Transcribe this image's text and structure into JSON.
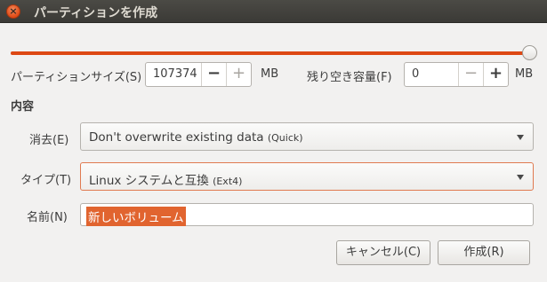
{
  "window": {
    "title": "パーティションを作成",
    "close_glyph": "×"
  },
  "slider": {
    "fill_fraction": 1.0,
    "accent": "#dd4814"
  },
  "size_field": {
    "label": "パーティションサイズ(S)",
    "value": "107374",
    "minus": "−",
    "plus": "+",
    "unit": "MB"
  },
  "free_field": {
    "label": "残り空き容量(F)",
    "value": "0",
    "minus": "−",
    "plus": "+",
    "unit": "MB"
  },
  "section_heading": "内容",
  "erase": {
    "label": "消去(E)",
    "value": "Don't overwrite existing data",
    "hint": "(Quick)"
  },
  "type": {
    "label": "タイプ(T)",
    "value": "Linux システムと互換",
    "hint": "(Ext4)"
  },
  "name": {
    "label": "名前(N)",
    "value": "新しいボリューム"
  },
  "buttons": {
    "cancel": "キャンセル(C)",
    "create": "作成(R)"
  }
}
